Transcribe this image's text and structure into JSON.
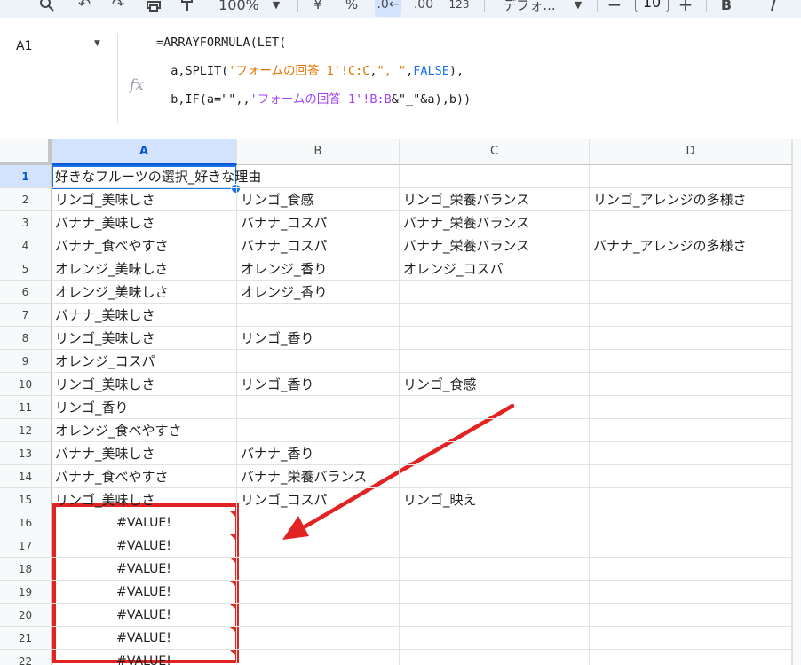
{
  "toolbar": {
    "zoom": "100%",
    "currency": "¥",
    "percent": "%",
    "number_format": "123",
    "font": "デフォ...",
    "font_size": "10",
    "bold": "B"
  },
  "formula_bar": {
    "cell_ref": "A1",
    "fx": "fx",
    "line1": "=ARRAYFORMULA(LET(",
    "line2": {
      "a": "  a,SPLIT(",
      "ref": "'フォームの回答 1'!C:C",
      "sep": ",",
      "str1": "\", \"",
      "comma": ",",
      "kw": "FALSE",
      "end": "),"
    },
    "line3": {
      "a": "  b,IF(a=\"\",,",
      "ref": "'フォームの回答 1'!B:B",
      "amp": "&\"_\"&a),b))"
    }
  },
  "grid": {
    "columns": [
      "A",
      "B",
      "C",
      "D"
    ],
    "rows": [
      {
        "n": "1",
        "a": "好きなフルーツの選択_好きな理由",
        "b": "",
        "c": "",
        "d": ""
      },
      {
        "n": "2",
        "a": "リンゴ_美味しさ",
        "b": "リンゴ_食感",
        "c": "リンゴ_栄養バランス",
        "d": "リンゴ_アレンジの多様さ"
      },
      {
        "n": "3",
        "a": "バナナ_美味しさ",
        "b": "バナナ_コスパ",
        "c": "バナナ_栄養バランス",
        "d": ""
      },
      {
        "n": "4",
        "a": "バナナ_食べやすさ",
        "b": "バナナ_コスパ",
        "c": "バナナ_栄養バランス",
        "d": "バナナ_アレンジの多様さ"
      },
      {
        "n": "5",
        "a": "オレンジ_美味しさ",
        "b": "オレンジ_香り",
        "c": "オレンジ_コスパ",
        "d": ""
      },
      {
        "n": "6",
        "a": "オレンジ_美味しさ",
        "b": "オレンジ_香り",
        "c": "",
        "d": ""
      },
      {
        "n": "7",
        "a": "バナナ_美味しさ",
        "b": "",
        "c": "",
        "d": ""
      },
      {
        "n": "8",
        "a": "リンゴ_美味しさ",
        "b": "リンゴ_香り",
        "c": "",
        "d": ""
      },
      {
        "n": "9",
        "a": "オレンジ_コスパ",
        "b": "",
        "c": "",
        "d": ""
      },
      {
        "n": "10",
        "a": "リンゴ_美味しさ",
        "b": "リンゴ_香り",
        "c": "リンゴ_食感",
        "d": ""
      },
      {
        "n": "11",
        "a": "リンゴ_香り",
        "b": "",
        "c": "",
        "d": ""
      },
      {
        "n": "12",
        "a": "オレンジ_食べやすさ",
        "b": "",
        "c": "",
        "d": ""
      },
      {
        "n": "13",
        "a": "バナナ_美味しさ",
        "b": "バナナ_香り",
        "c": "",
        "d": ""
      },
      {
        "n": "14",
        "a": "バナナ_食べやすさ",
        "b": "バナナ_栄養バランス",
        "c": "",
        "d": ""
      },
      {
        "n": "15",
        "a": "リンゴ_美味しさ",
        "b": "リンゴ_コスパ",
        "c": "リンゴ_映え",
        "d": ""
      },
      {
        "n": "16",
        "a": "#VALUE!",
        "b": "",
        "c": "",
        "d": "",
        "err": true
      },
      {
        "n": "17",
        "a": "#VALUE!",
        "b": "",
        "c": "",
        "d": "",
        "err": true
      },
      {
        "n": "18",
        "a": "#VALUE!",
        "b": "",
        "c": "",
        "d": "",
        "err": true
      },
      {
        "n": "19",
        "a": "#VALUE!",
        "b": "",
        "c": "",
        "d": "",
        "err": true
      },
      {
        "n": "20",
        "a": "#VALUE!",
        "b": "",
        "c": "",
        "d": "",
        "err": true
      },
      {
        "n": "21",
        "a": "#VALUE!",
        "b": "",
        "c": "",
        "d": "",
        "err": true
      },
      {
        "n": "22",
        "a": "#VALUE!",
        "b": "",
        "c": "",
        "d": "",
        "err": true
      }
    ]
  },
  "colors": {
    "accent": "#1a73e8",
    "annotation": "#e32222",
    "error_marker": "#d93025"
  }
}
